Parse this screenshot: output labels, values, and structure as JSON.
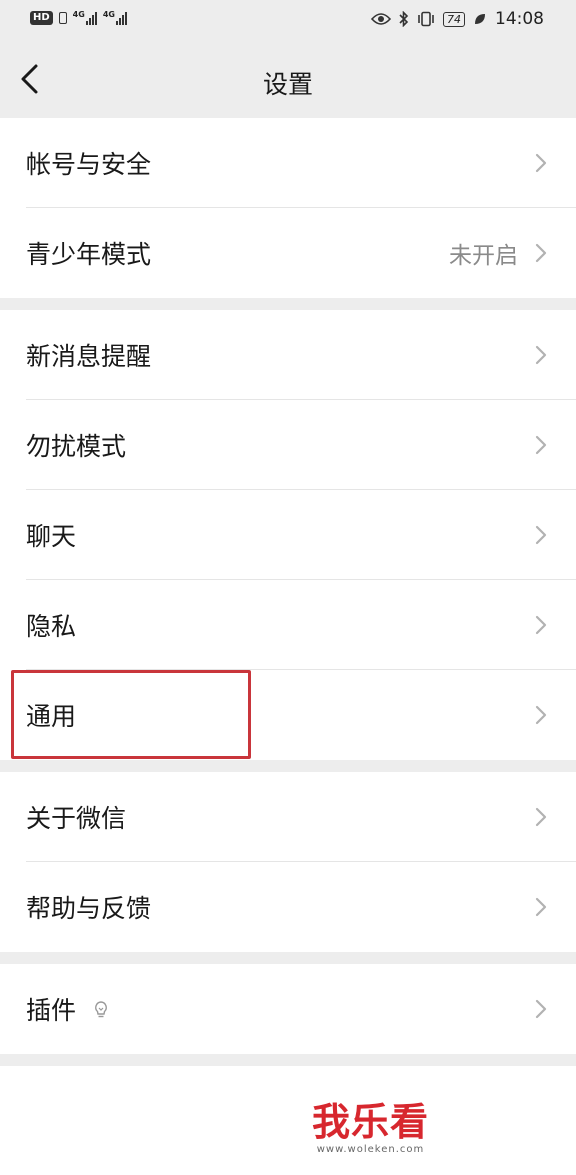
{
  "status_bar": {
    "hd": "HD",
    "net1": "4G",
    "net2": "4G",
    "battery": "74",
    "time": "14:08"
  },
  "header": {
    "title": "设置"
  },
  "groups": [
    {
      "items": [
        {
          "label": "帐号与安全",
          "value": ""
        },
        {
          "label": "青少年模式",
          "value": "未开启"
        }
      ]
    },
    {
      "items": [
        {
          "label": "新消息提醒",
          "value": ""
        },
        {
          "label": "勿扰模式",
          "value": ""
        },
        {
          "label": "聊天",
          "value": ""
        },
        {
          "label": "隐私",
          "value": ""
        },
        {
          "label": "通用",
          "value": ""
        }
      ]
    },
    {
      "items": [
        {
          "label": "关于微信",
          "value": ""
        },
        {
          "label": "帮助与反馈",
          "value": ""
        }
      ]
    },
    {
      "items": [
        {
          "label": "插件",
          "value": ""
        }
      ]
    }
  ],
  "watermark": {
    "logo": "我乐看",
    "url": "www.woleken.com"
  },
  "colors": {
    "background": "#ededed",
    "card": "#ffffff",
    "highlight": "#c9353b",
    "watermark": "#d7272e"
  }
}
